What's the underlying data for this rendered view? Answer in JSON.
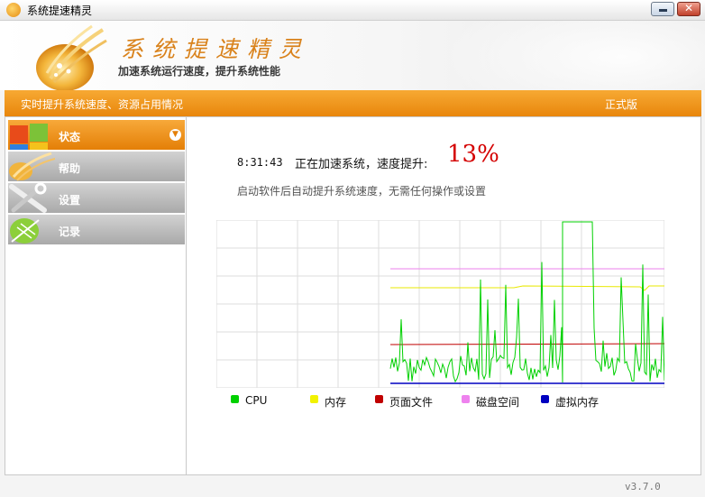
{
  "window": {
    "title": "系统提速精灵"
  },
  "header": {
    "brand": "系统提速精灵",
    "slogan": "加速系统运行速度，提升系统性能"
  },
  "bar": {
    "left": "实时提升系统速度、资源占用情况",
    "right": "正式版"
  },
  "sidebar": {
    "items": [
      {
        "label": "状态",
        "icon": "orange-window-icon",
        "active": true
      },
      {
        "label": "帮助",
        "icon": "wheat-icon",
        "active": false
      },
      {
        "label": "设置",
        "icon": "tools-icon",
        "active": false
      },
      {
        "label": "记录",
        "icon": "leaf-icon",
        "active": false
      }
    ]
  },
  "status": {
    "time": "8:31:43",
    "text": "正在加速系统，速度提升:",
    "percent": "13%",
    "note": "启动软件后自动提升系统速度，无需任何操作或设置"
  },
  "colors": {
    "accent": "#e8860c",
    "cpu": "#00d000",
    "memory": "#f2f200",
    "pagefile": "#c00000",
    "disk": "#ee82ee",
    "virtual_memory": "#0000c0"
  },
  "chart_data": {
    "type": "line",
    "series": [
      {
        "name": "CPU",
        "color": "#00d000"
      },
      {
        "name": "内存",
        "color": "#f2f200"
      },
      {
        "name": "页面文件",
        "color": "#c00000"
      },
      {
        "name": "磁盘空间",
        "color": "#ee82ee"
      },
      {
        "name": "虚拟内存",
        "color": "#0000c0"
      }
    ],
    "grid": true,
    "legend_position": "bottom"
  },
  "footer": {
    "version": "v3.7.0"
  }
}
